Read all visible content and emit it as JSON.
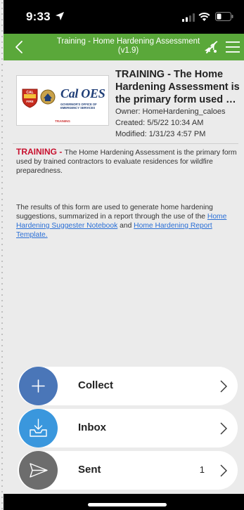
{
  "status_bar": {
    "time": "9:33"
  },
  "header": {
    "title_line1": "Training - Home Hardening Assessment",
    "title_line2": "(v1.9)"
  },
  "thumbnail": {
    "logo_text": "Cal OES",
    "logo_subtitle": "GOVERNOR'S OFFICE OF EMERGENCY SERVICES",
    "badge_text": "TRAINING"
  },
  "form": {
    "title_line1": "TRAINING - The Home",
    "title_line2": "Hardening Assessment is",
    "title_line3": "the primary form used b...",
    "owner": "Owner: HomeHardening_caloes",
    "created": "Created: 5/5/22 10:34 AM",
    "modified": "Modified: 1/31/23 4:57 PM"
  },
  "description": {
    "lead": "TRAINING - ",
    "text": "The Home Hardening Assessment is the primary form used by trained contractors to evaluate residences for wildfire preparedness.",
    "p2_text1": "The results of this form are used to generate home hardening suggestions, summarized in a report through the use of the ",
    "link1": "Home Hardening Suggester Notebook",
    "p2_text2": " and ",
    "link2": "Home Hardening Report Template."
  },
  "actions": [
    {
      "label": "Collect",
      "color": "#4a76b8",
      "icon": "plus-icon"
    },
    {
      "label": "Inbox",
      "color": "#3a97dd",
      "icon": "inbox-icon"
    },
    {
      "label": "Sent",
      "count": "1",
      "color": "#6d6d6d",
      "icon": "send-icon"
    }
  ],
  "colors": {
    "header": "#5aa83a",
    "training_red": "#c8102e",
    "link": "#2a6fd6"
  }
}
